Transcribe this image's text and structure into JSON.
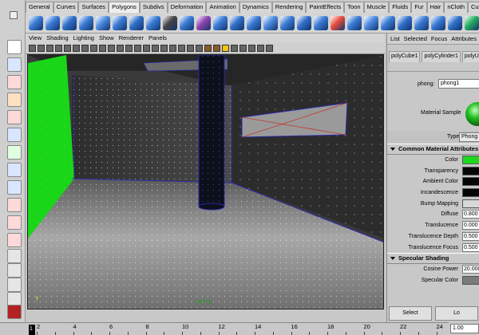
{
  "shelf": {
    "tabs": [
      "General",
      "Curves",
      "Surfaces",
      "Polygons",
      "Subdivs",
      "Deformation",
      "Animation",
      "Dynamics",
      "Rendering",
      "PaintEffects",
      "Toon",
      "Muscle",
      "Fluids",
      "Fur",
      "Hair",
      "nCloth",
      "Custom"
    ],
    "active_tab": "Polygons"
  },
  "panel_menu": [
    "View",
    "Shading",
    "Lighting",
    "Show",
    "Renderer",
    "Panels"
  ],
  "viewport": {
    "camera_label": "persp",
    "axis_label": "y"
  },
  "attribute_editor": {
    "menu": [
      "List",
      "Selected",
      "Focus",
      "Attributes"
    ],
    "node_tabs": [
      "polyCube1",
      "polyCylinder1",
      "polyUnite"
    ],
    "name_label": "phong:",
    "name_value": "phong1",
    "sample_label": "Material Sample",
    "type_label": "Type",
    "type_value": "Phong",
    "section_common": "Common Material Attributes",
    "attributes": [
      {
        "label": "Color",
        "kind": "swatch",
        "color": "#1ed81e"
      },
      {
        "label": "Transparency",
        "kind": "swatch",
        "color": "#050505"
      },
      {
        "label": "Ambient Color",
        "kind": "swatch",
        "color": "#050505"
      },
      {
        "label": "Incandescence",
        "kind": "swatch",
        "color": "#050505"
      },
      {
        "label": "Bump Mapping",
        "kind": "swatch",
        "color": "#d8d8d8"
      },
      {
        "label": "Diffuse",
        "kind": "number",
        "value": "0.800"
      },
      {
        "label": "Translucence",
        "kind": "number",
        "value": "0.000"
      },
      {
        "label": "Translucence Depth",
        "kind": "number",
        "value": "0.500"
      },
      {
        "label": "Translucence Focus",
        "kind": "number",
        "value": "0.500"
      }
    ],
    "section_specular": "Specular Shading",
    "specular": [
      {
        "label": "Cosine Power",
        "kind": "number",
        "value": "20.000"
      },
      {
        "label": "Specular Color",
        "kind": "swatch",
        "color": "#7a7a7a"
      }
    ],
    "select_button": "Select",
    "load_button": "Lo"
  },
  "timeline": {
    "current_frame": "1",
    "ticks": [
      "2",
      "4",
      "6",
      "8",
      "10",
      "12",
      "14",
      "16",
      "18",
      "20",
      "22",
      "24"
    ],
    "frame_field": "1.00"
  },
  "colors": {
    "green_wall": "#19d619",
    "floor": "#888888",
    "pillar": "#0c0f1c",
    "wireframe": "#2a2aa8",
    "window_cross": "#c0392b"
  }
}
